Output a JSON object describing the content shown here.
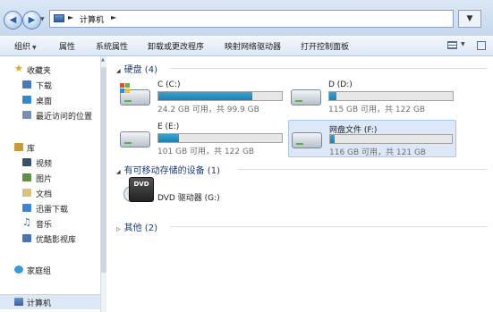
{
  "addressbar": {
    "path_item": "计算机",
    "back_icon": "back-arrow-icon",
    "forward_icon": "forward-arrow-icon",
    "refresh_icon": "refresh-icon"
  },
  "toolbar": {
    "items": [
      {
        "label": "组织",
        "has_dropdown": true
      },
      {
        "label": "属性"
      },
      {
        "label": "系统属性"
      },
      {
        "label": "卸载或更改程序"
      },
      {
        "label": "映射网络驱动器"
      },
      {
        "label": "打开控制面板"
      }
    ],
    "view_icon": "view-options-icon",
    "pane_icon": "preview-pane-icon"
  },
  "sidebar": {
    "favorites": {
      "label": "收藏夹",
      "items": [
        {
          "label": "下载",
          "icon": "download-folder-icon"
        },
        {
          "label": "桌面",
          "icon": "desktop-icon"
        },
        {
          "label": "最近访问的位置",
          "icon": "recent-places-icon"
        }
      ]
    },
    "libraries": {
      "label": "库",
      "items": [
        {
          "label": "视频",
          "icon": "video-library-icon"
        },
        {
          "label": "图片",
          "icon": "picture-library-icon"
        },
        {
          "label": "文档",
          "icon": "document-library-icon"
        },
        {
          "label": "迅雷下载",
          "icon": "xunlei-download-icon"
        },
        {
          "label": "音乐",
          "icon": "music-library-icon"
        },
        {
          "label": "优酷影视库",
          "icon": "youku-library-icon"
        }
      ]
    },
    "homegroup": {
      "label": "家庭组"
    },
    "computer": {
      "label": "计算机"
    }
  },
  "content": {
    "hard_disks": {
      "header": "硬盘 (4)",
      "drives": [
        {
          "name": "C (C:)",
          "free_text": "24.2 GB 可用，共 99.9 GB",
          "used_fraction": 0.76,
          "icon": "windows-drive-icon"
        },
        {
          "name": "D (D:)",
          "free_text": "115 GB 可用，共 122 GB",
          "used_fraction": 0.06,
          "icon": "hard-drive-icon"
        },
        {
          "name": "E (E:)",
          "free_text": "101 GB 可用，共 122 GB",
          "used_fraction": 0.17,
          "icon": "hard-drive-icon"
        },
        {
          "name": "网盘文件 (F:)",
          "free_text": "116 GB 可用，共 121 GB",
          "used_fraction": 0.04,
          "icon": "hard-drive-icon"
        }
      ]
    },
    "removable": {
      "header": "有可移动存储的设备 (1)",
      "dvd_name": "DVD 驱动器 (G:)",
      "dvd_icon_text": "DVD"
    },
    "other": {
      "header": "其他 (2)"
    }
  }
}
